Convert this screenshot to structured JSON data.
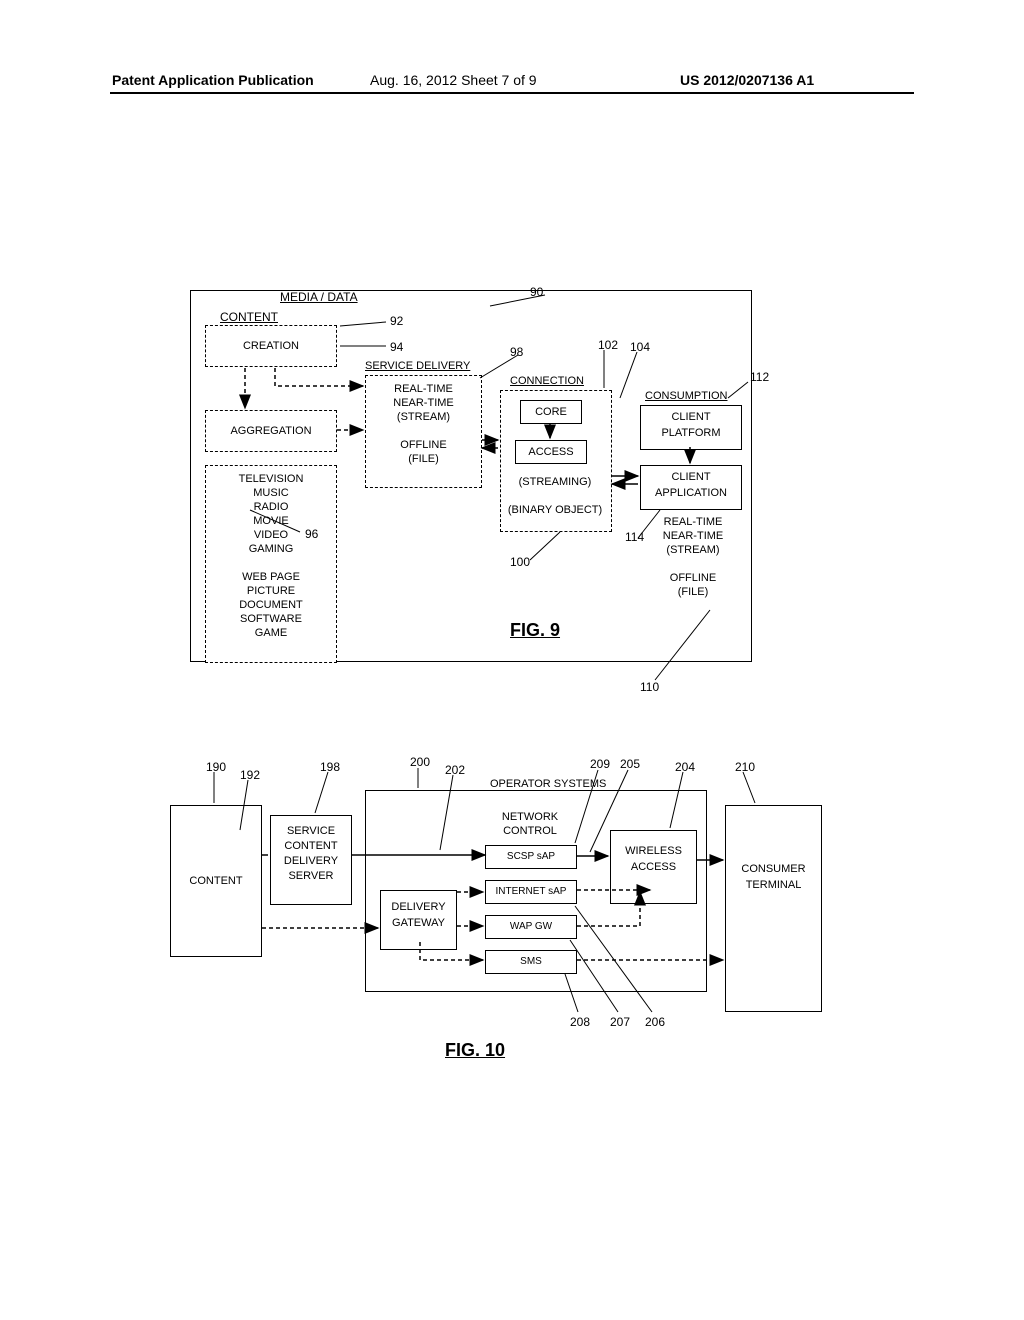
{
  "header": {
    "left": "Patent Application Publication",
    "mid": "Aug. 16, 2012   Sheet 7 of 9",
    "right": "US 2012/0207136 A1"
  },
  "fig9": {
    "title": "FIG. 9",
    "media_data": "MEDIA / DATA",
    "content": "CONTENT",
    "creation": "CREATION",
    "aggregation": "AGGREGATION",
    "content_types": "TELEVISION\nMUSIC\nRADIO\nMOVIE\nVIDEO\nGAMING\n\nWEB PAGE\nPICTURE\nDOCUMENT\nSOFTWARE\nGAME",
    "service_delivery": "SERVICE DELIVERY",
    "sd_items": "REAL-TIME\nNEAR-TIME\n(STREAM)\n\nOFFLINE\n(FILE)",
    "connection": "CONNECTION",
    "core": "CORE",
    "access": "ACCESS",
    "conn_items": "(STREAMING)\n\n(BINARY OBJECT)",
    "consumption": "CONSUMPTION",
    "client_platform": "CLIENT\nPLATFORM",
    "client_application": "CLIENT\nAPPLICATION",
    "cons_items": "REAL-TIME\nNEAR-TIME\n(STREAM)\n\nOFFLINE\n(FILE)",
    "refs": {
      "r90": "90",
      "r92": "92",
      "r94": "94",
      "r96": "96",
      "r98": "98",
      "r100": "100",
      "r102": "102",
      "r104": "104",
      "r110": "110",
      "r112": "112",
      "r114": "114"
    }
  },
  "fig10": {
    "title": "FIG. 10",
    "content": "CONTENT",
    "scds": "SERVICE\nCONTENT\nDELIVERY\nSERVER",
    "op_systems": "OPERATOR SYSTEMS",
    "delivery_gateway": "DELIVERY\nGATEWAY",
    "network_control": "NETWORK\nCONTROL",
    "scsp_sap": "SCSP sAP",
    "internet_sap": "INTERNET sAP",
    "wap_gw": "WAP GW",
    "sms": "SMS",
    "wireless_access": "WIRELESS\nACCESS",
    "consumer_terminal": "CONSUMER\nTERMINAL",
    "refs": {
      "r190": "190",
      "r192": "192",
      "r198": "198",
      "r200": "200",
      "r202": "202",
      "r204": "204",
      "r205": "205",
      "r206": "206",
      "r207": "207",
      "r208": "208",
      "r209": "209",
      "r210": "210"
    }
  }
}
